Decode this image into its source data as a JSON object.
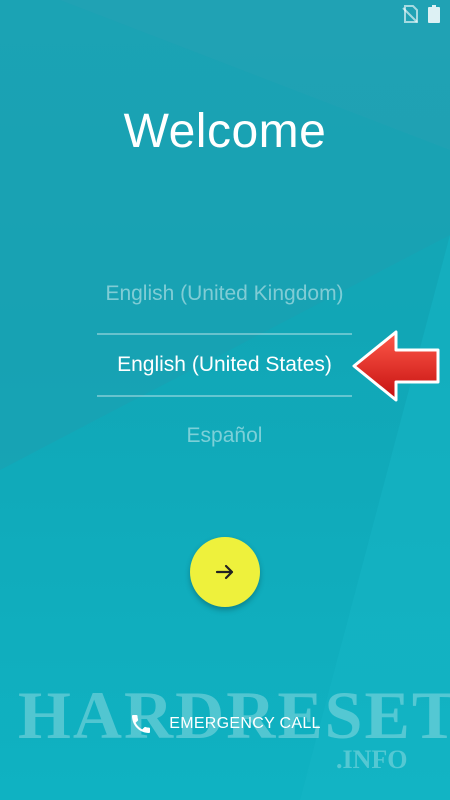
{
  "status_bar": {
    "icons": [
      "no-sim-icon",
      "battery-icon"
    ]
  },
  "title": "Welcome",
  "languages": [
    {
      "label": "English (United Kingdom)",
      "selected": false
    },
    {
      "label": "English (United States)",
      "selected": true
    },
    {
      "label": "Español",
      "selected": false
    }
  ],
  "next_button": {
    "icon": "arrow-right-icon"
  },
  "emergency": {
    "label": "EMERGENCY CALL",
    "icon": "phone-icon"
  },
  "watermark": {
    "main": "HARDRESET",
    "sub": ".INFO"
  },
  "colors": {
    "background": "#11a6b6",
    "accent_button": "#eef13c",
    "pointer_arrow": "#e41f1f",
    "text": "#ffffff"
  }
}
